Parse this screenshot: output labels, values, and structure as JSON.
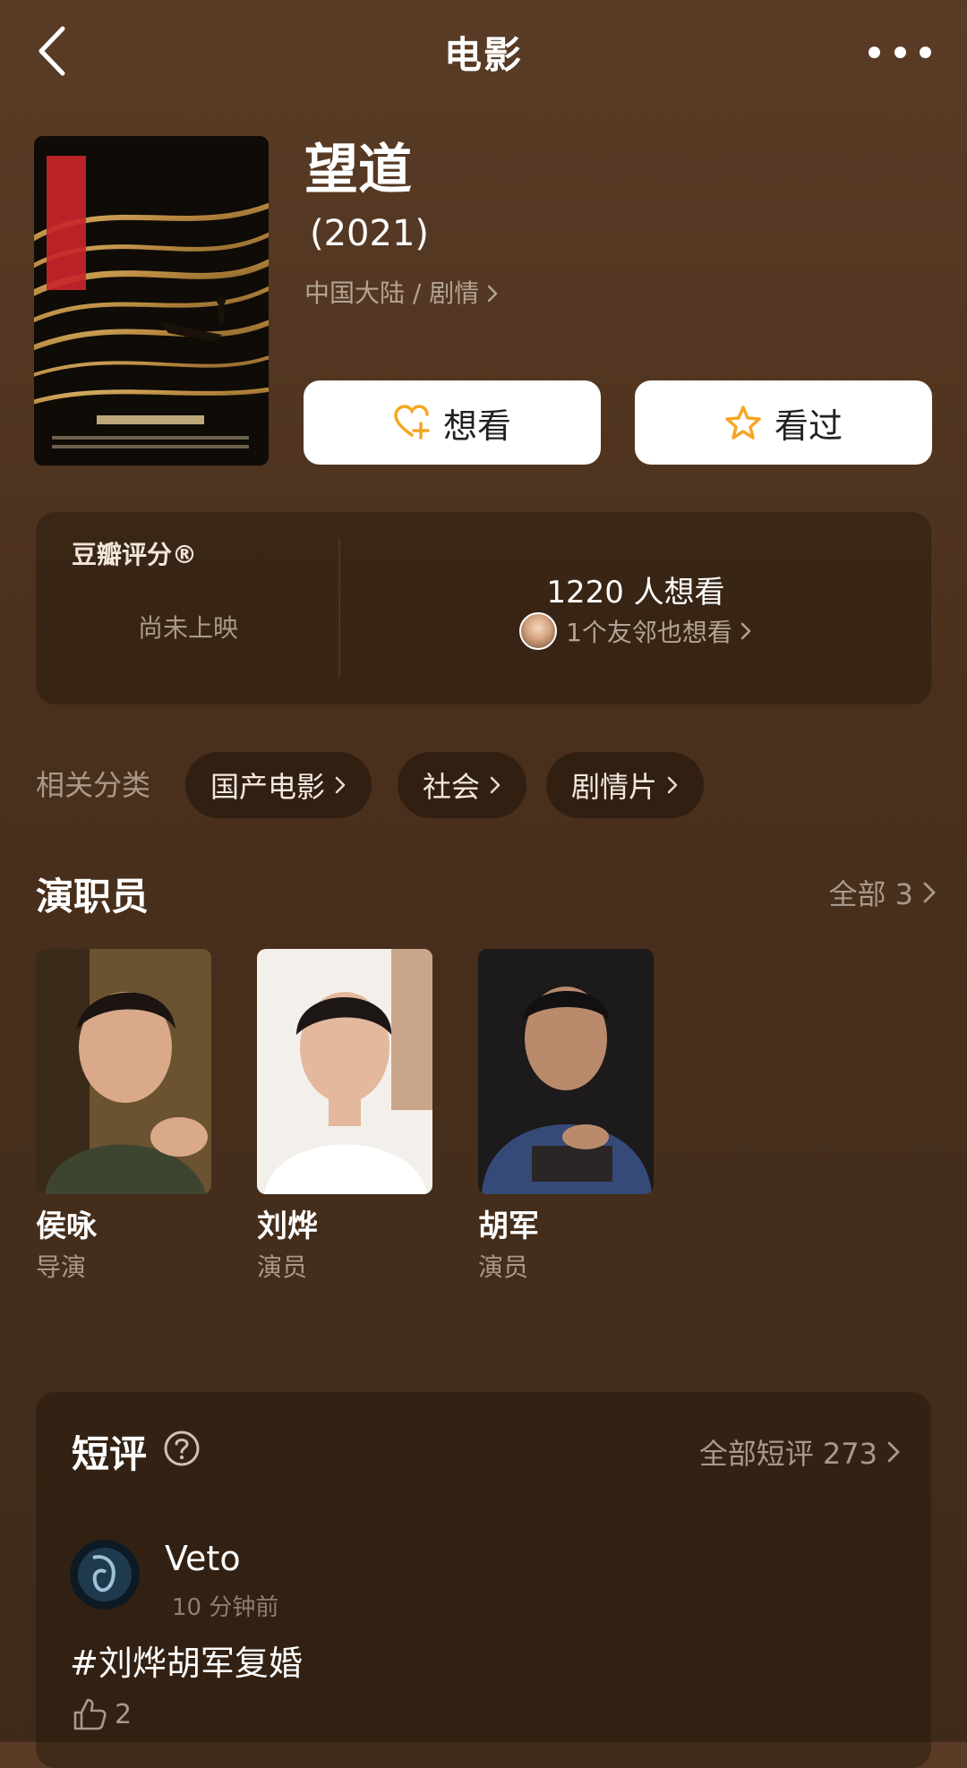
{
  "topbar": {
    "title": "电影",
    "back_icon": "chevron-left-icon",
    "more_icon": "more-dots-icon"
  },
  "movie": {
    "title": "望道",
    "year": "(2021)",
    "meta": "中国大陆 / 剧情"
  },
  "actions": {
    "want_label": "想看",
    "want_icon": "heart-plus-icon",
    "seen_label": "看过",
    "seen_icon": "star-icon",
    "accent_color": "#f5a623"
  },
  "rating": {
    "label": "豆瓣评分®",
    "status": "尚未上映",
    "want_count": "1220 人想看",
    "friends_text": "1个友邻也想看"
  },
  "related": {
    "label": "相关分类",
    "chips": [
      "国产电影",
      "社会",
      "剧情片"
    ]
  },
  "cast": {
    "title": "演职员",
    "all_label": "全部 3",
    "members": [
      {
        "name": "侯咏",
        "role": "导演"
      },
      {
        "name": "刘烨",
        "role": "演员"
      },
      {
        "name": "胡军",
        "role": "演员"
      }
    ]
  },
  "reviews": {
    "title": "短评",
    "all_label": "全部短评 273",
    "items": [
      {
        "user": "Veto",
        "time": "10 分钟前",
        "text": "#刘烨胡军复婚",
        "likes": "2"
      }
    ]
  }
}
